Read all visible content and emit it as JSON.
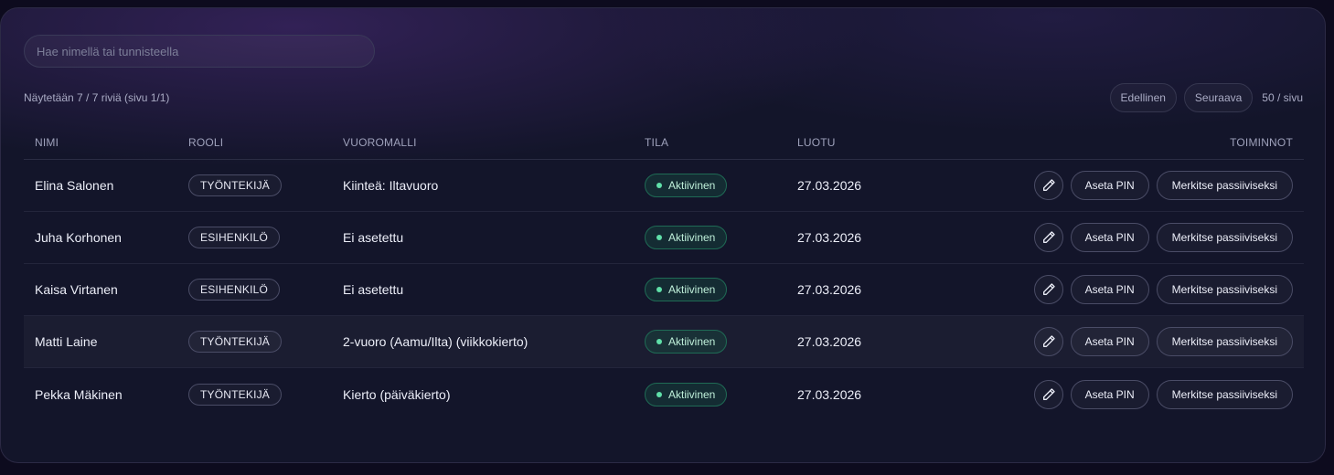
{
  "search": {
    "placeholder": "Hae nimellä tai tunnisteella",
    "value": ""
  },
  "status_line": "Näytetään 7 / 7 riviä (sivu 1/1)",
  "pager": {
    "prev_label": "Edellinen",
    "next_label": "Seuraava",
    "page_size": "50 / sivu"
  },
  "columns": {
    "name": "NIMI",
    "role": "ROOLI",
    "shift": "VUOROMALLI",
    "status": "TILA",
    "created": "LUOTU",
    "actions": "TOIMINNOT"
  },
  "actions": {
    "set_pin": "Aseta PIN",
    "mark_passive": "Merkitse passiiviseksi",
    "edit_icon": "pencil-icon"
  },
  "rows": [
    {
      "name": "Elina Salonen",
      "role": "TYÖNTEKIJÄ",
      "shift": "Kiinteä: Iltavuoro",
      "status": "Aktiivinen",
      "created": "27.03.2026"
    },
    {
      "name": "Juha Korhonen",
      "role": "ESIHENKILÖ",
      "shift": "Ei asetettu",
      "status": "Aktiivinen",
      "created": "27.03.2026"
    },
    {
      "name": "Kaisa Virtanen",
      "role": "ESIHENKILÖ",
      "shift": "Ei asetettu",
      "status": "Aktiivinen",
      "created": "27.03.2026"
    },
    {
      "name": "Matti Laine",
      "role": "TYÖNTEKIJÄ",
      "shift": "2-vuoro (Aamu/Ilta) (viikkokierto)",
      "status": "Aktiivinen",
      "created": "27.03.2026"
    },
    {
      "name": "Pekka Mäkinen",
      "role": "TYÖNTEKIJÄ",
      "shift": "Kierto (päiväkierto)",
      "status": "Aktiivinen",
      "created": "27.03.2026"
    }
  ],
  "colors": {
    "accent_status": "#5fe0a8",
    "background": "#13152a",
    "glow": "#58308c"
  }
}
